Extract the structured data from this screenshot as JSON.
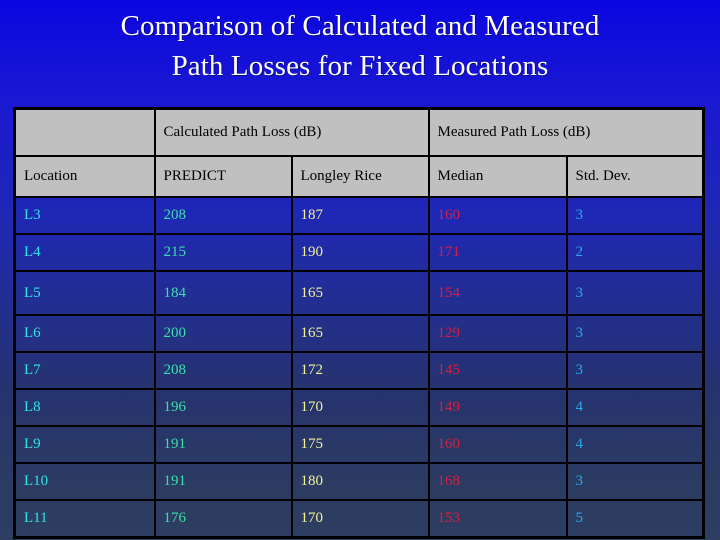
{
  "slide": {
    "title_lines": [
      "Comparison of Calculated and Measured",
      "Path Losses for Fixed Locations"
    ],
    "background_top_color": "#0a06e0",
    "background_bottom_color": "#2c3c60",
    "title_color": "#ffffff"
  },
  "table": {
    "group_headers": {
      "blank": "",
      "calculated": "Calculated Path Loss (dB)",
      "measured": "Measured Path Loss (dB)"
    },
    "columns": [
      {
        "key": "location",
        "label": "Location",
        "color": "#2ee4e4"
      },
      {
        "key": "predict",
        "label": "PREDICT",
        "color": "#3ae0a8"
      },
      {
        "key": "longley",
        "label": "Longley Rice",
        "color": "#f2f29a"
      },
      {
        "key": "median",
        "label": "Median",
        "color": "#d42042"
      },
      {
        "key": "stddev",
        "label": "Std. Dev.",
        "color": "#2aa8e8"
      }
    ],
    "header_bg_color": "#c0c0c0",
    "header_text_color": "#000000",
    "border_color": "#000000",
    "rows": [
      {
        "location": "L3",
        "predict": "208",
        "longley": "187",
        "median": "160",
        "stddev": "3"
      },
      {
        "location": "L4",
        "predict": "215",
        "longley": "190",
        "median": "171",
        "stddev": "2"
      },
      {
        "location": "L5",
        "predict": "184",
        "longley": "165",
        "median": "154",
        "stddev": "3"
      },
      {
        "location": "L6",
        "predict": "200",
        "longley": "165",
        "median": "129",
        "stddev": "3"
      },
      {
        "location": "L7",
        "predict": "208",
        "longley": "172",
        "median": "145",
        "stddev": "3"
      },
      {
        "location": "L8",
        "predict": "196",
        "longley": "170",
        "median": "149",
        "stddev": "4"
      },
      {
        "location": "L9",
        "predict": "191",
        "longley": "175",
        "median": "160",
        "stddev": "4"
      },
      {
        "location": "L10",
        "predict": "191",
        "longley": "180",
        "median": "168",
        "stddev": "3"
      },
      {
        "location": "L11",
        "predict": "176",
        "longley": "170",
        "median": "153",
        "stddev": "5"
      }
    ]
  },
  "chart_data": {
    "type": "table",
    "title": "Comparison of Calculated and Measured Path Losses for Fixed Locations",
    "columns": [
      "Location",
      "PREDICT",
      "Longley Rice",
      "Median",
      "Std. Dev."
    ],
    "column_groups": [
      {
        "label": "",
        "span": 1
      },
      {
        "label": "Calculated Path Loss (dB)",
        "span": 2
      },
      {
        "label": "Measured Path Loss (dB)",
        "span": 2
      }
    ],
    "units": "dB",
    "categories": [
      "L3",
      "L4",
      "L5",
      "L6",
      "L7",
      "L8",
      "L9",
      "L10",
      "L11"
    ],
    "series": [
      {
        "name": "PREDICT",
        "values": [
          208,
          215,
          184,
          200,
          208,
          196,
          191,
          191,
          176
        ]
      },
      {
        "name": "Longley Rice",
        "values": [
          187,
          190,
          165,
          165,
          172,
          170,
          175,
          180,
          170
        ]
      },
      {
        "name": "Median",
        "values": [
          160,
          171,
          154,
          129,
          145,
          149,
          160,
          168,
          153
        ]
      },
      {
        "name": "Std. Dev.",
        "values": [
          3,
          2,
          3,
          3,
          3,
          4,
          4,
          3,
          5
        ]
      }
    ],
    "xlabel": "Location",
    "ylabel": "Path Loss (dB)"
  }
}
